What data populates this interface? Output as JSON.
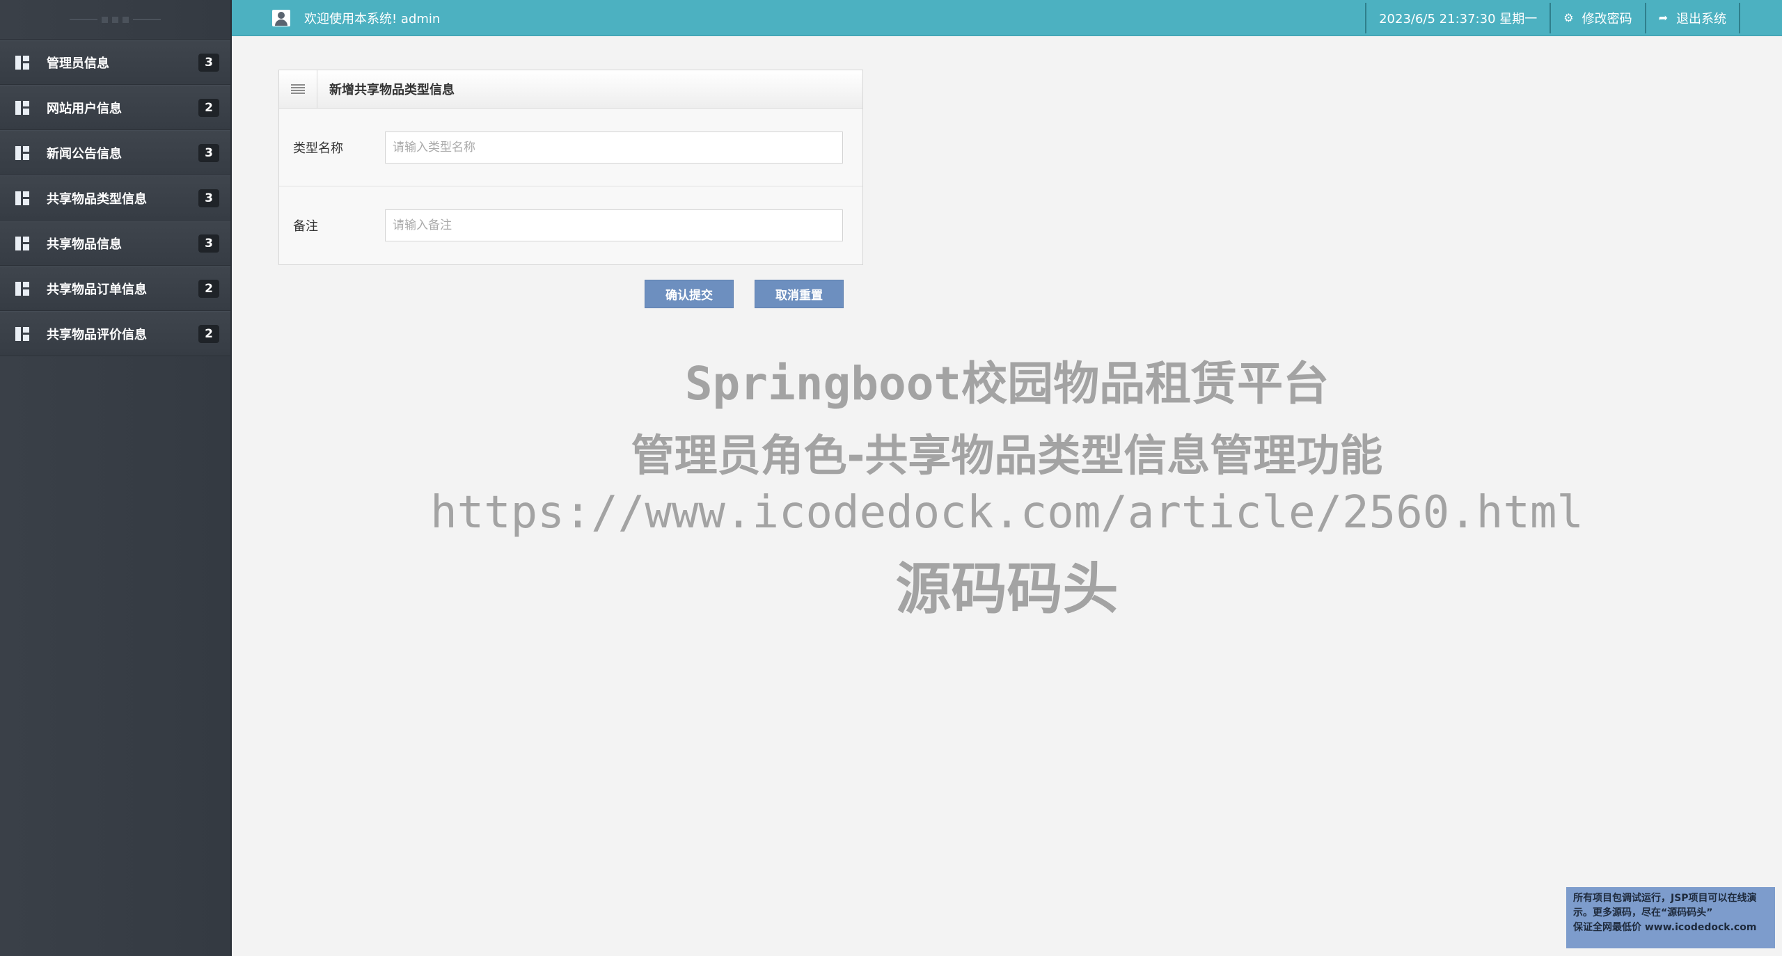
{
  "sidebar": {
    "items": [
      {
        "label": "管理员信息",
        "badge": "3"
      },
      {
        "label": "网站用户信息",
        "badge": "2"
      },
      {
        "label": "新闻公告信息",
        "badge": "3"
      },
      {
        "label": "共享物品类型信息",
        "badge": "3"
      },
      {
        "label": "共享物品信息",
        "badge": "3"
      },
      {
        "label": "共享物品订单信息",
        "badge": "2"
      },
      {
        "label": "共享物品评价信息",
        "badge": "2"
      }
    ]
  },
  "header": {
    "welcome": "欢迎使用本系统! admin",
    "datetime": "2023/6/5 21:37:30 星期一",
    "change_password": "修改密码",
    "logout": "退出系统"
  },
  "form": {
    "title": "新增共享物品类型信息",
    "fields": [
      {
        "label": "类型名称",
        "value": "",
        "placeholder": "请输入类型名称"
      },
      {
        "label": "备注",
        "value": "",
        "placeholder": "请输入备注"
      }
    ],
    "submit_label": "确认提交",
    "reset_label": "取消重置"
  },
  "watermark": {
    "line1": "Springboot校园物品租赁平台",
    "line2": "管理员角色-共享物品类型信息管理功能",
    "line3": "https://www.icodedock.com/article/2560.html",
    "line4": "源码码头"
  },
  "corner_note": {
    "line1": "所有项目包调试运行，JSP项目可以在线演",
    "line2": "示。更多源码，尽在“源码码头”",
    "line3": "保证全网最低价 www.icodedock.com"
  },
  "colors": {
    "topbar": "#4cb1c1",
    "sidebar": "#3a4048",
    "button": "#6d8fbf"
  }
}
